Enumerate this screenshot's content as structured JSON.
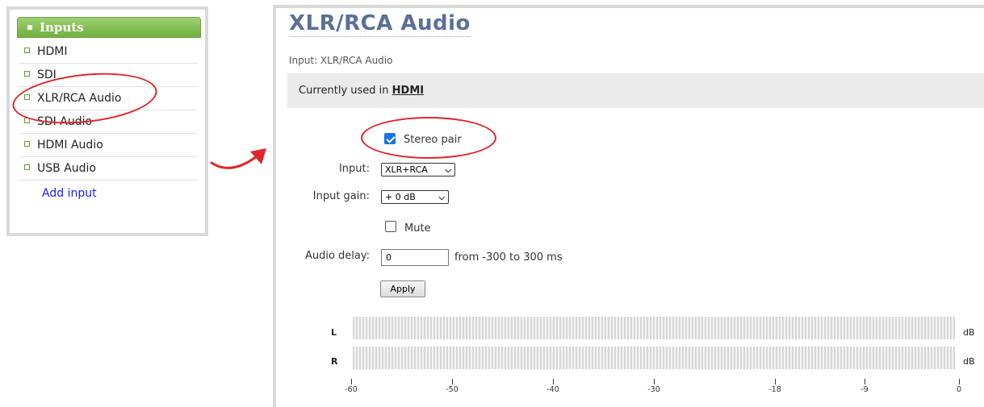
{
  "sidebar": {
    "header": "Inputs",
    "items": [
      {
        "label": "HDMI"
      },
      {
        "label": "SDI"
      },
      {
        "label": "XLR/RCA Audio"
      },
      {
        "label": "SDI Audio"
      },
      {
        "label": "HDMI Audio"
      },
      {
        "label": "USB Audio"
      }
    ],
    "add_input": "Add input"
  },
  "main": {
    "title": "XLR/RCA Audio",
    "subtitle": "Input: XLR/RCA Audio",
    "used_prefix": "Currently used in",
    "used_link": "HDMI",
    "stereo_label": "Stereo pair",
    "stereo_checked": true,
    "input_label": "Input:",
    "input_value": "XLR+RCA",
    "gain_label": "Input gain:",
    "gain_value": "+ 0 dB",
    "mute_label": "Mute",
    "mute_checked": false,
    "delay_label": "Audio delay:",
    "delay_value": "0",
    "delay_range": "from -300 to 300 ms",
    "apply_label": "Apply"
  },
  "meters": {
    "left_label": "L",
    "right_label": "R",
    "unit": "dB",
    "scale": [
      "-60",
      "-50",
      "-40",
      "-30",
      "-18",
      "-9",
      "0"
    ]
  },
  "colors": {
    "annotation": "#e0262a",
    "header_green": "#6fb13c",
    "title": "#5b6f97",
    "link": "#1a1aff"
  }
}
